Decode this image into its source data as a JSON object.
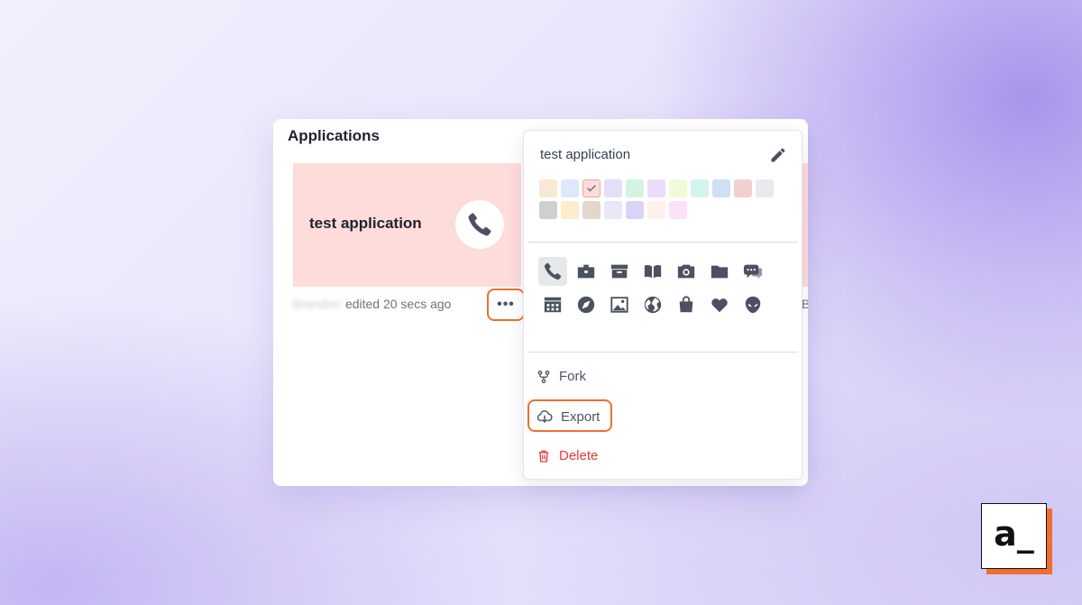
{
  "panel": {
    "title": "Applications"
  },
  "app_card": {
    "name": "test application",
    "color": "#fddcda",
    "icon": "phone-icon",
    "owner": "Brandon",
    "edited_text": "edited 20 secs ago",
    "more_label": "•••"
  },
  "peek_card": {
    "meta_fragment": "Br"
  },
  "context_menu": {
    "app_name": "test application",
    "colors": [
      "#fbe8d4",
      "#dde8fb",
      "#fddcda",
      "#e4def9",
      "#d4f4e3",
      "#ecdcf9",
      "#f1fad9",
      "#d2f4ee",
      "#cfe0f5",
      "#f2d0d0",
      "#e8eaed",
      "#cfcfcf",
      "#fbeecb",
      "#e4d6cb",
      "#e9e8f9",
      "#dbd2f7",
      "#fff1ee",
      "#fbe2fb"
    ],
    "selected_color_index": 2,
    "icons": [
      "phone-icon",
      "briefcase-icon",
      "archive-icon",
      "book-icon",
      "camera-icon",
      "folder-icon",
      "chat-icon",
      "calendar-icon",
      "compass-icon",
      "image-icon",
      "globe-icon",
      "shopping-bag-icon",
      "heart-icon",
      "alien-icon",
      "bars-icon",
      "rows-icon",
      "brackets-icon",
      "pin-icon",
      "saturn-icon",
      "dashboard-icon",
      "frame-icon"
    ],
    "selected_icon_index": 0,
    "fork_label": "Fork",
    "export_label": "Export",
    "delete_label": "Delete"
  },
  "brand": {
    "logo_text": "a_"
  },
  "accent_color": "#f06e2e",
  "danger_color": "#e53935"
}
